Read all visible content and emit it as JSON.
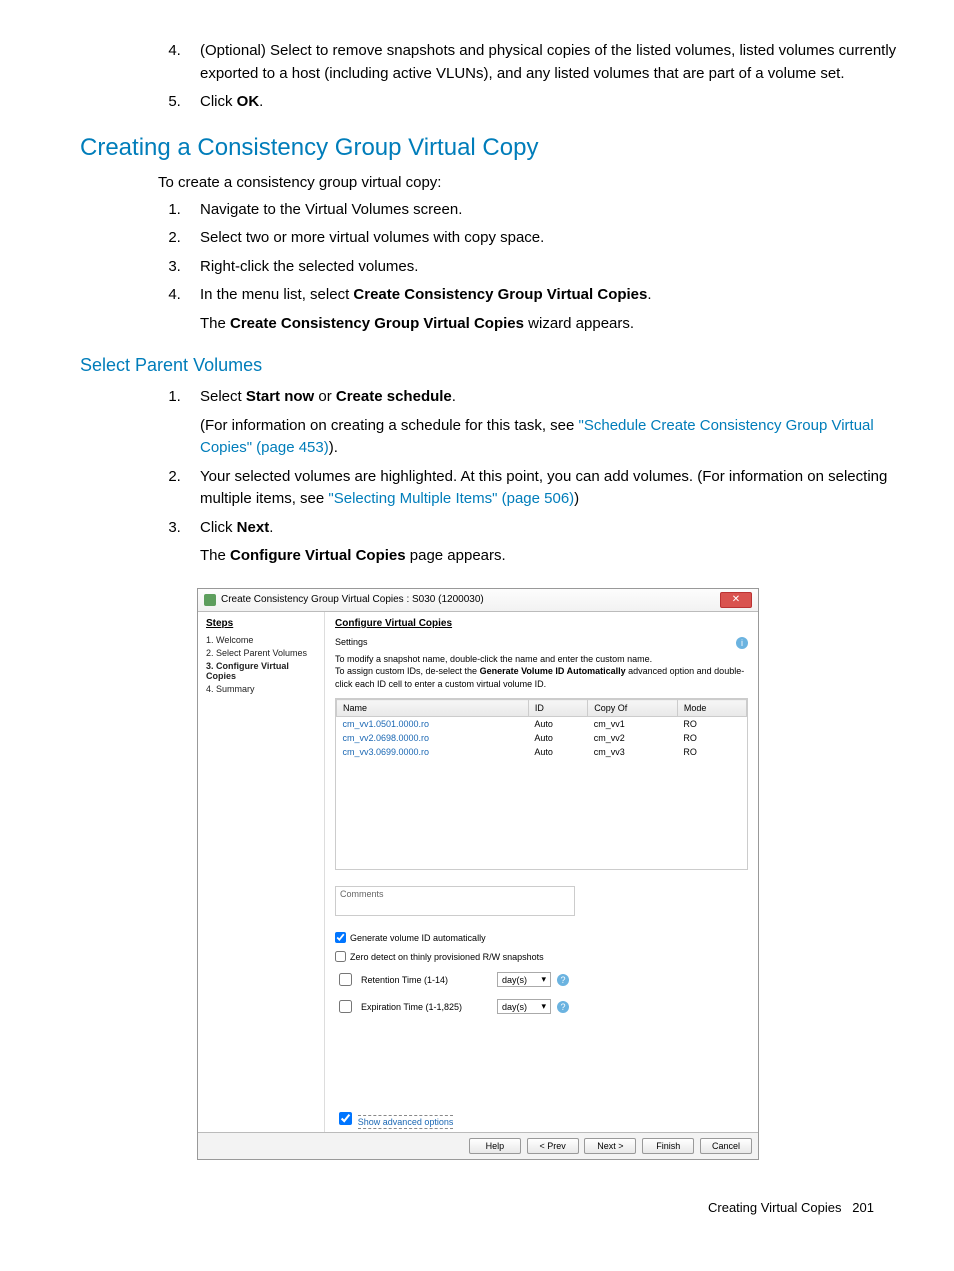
{
  "intro_list": {
    "start": 4,
    "item4": "(Optional) Select to remove snapshots and physical copies of the listed volumes, listed volumes currently exported to a host (including active VLUNs), and any listed volumes that are part of a volume set.",
    "item5_pre": "Click ",
    "item5_bold": "OK",
    "item5_post": "."
  },
  "heading1": "Creating a Consistency Group Virtual Copy",
  "intro1": "To create a consistency group virtual copy:",
  "steps1": {
    "s1": "Navigate to the Virtual Volumes screen.",
    "s2": "Select two or more virtual volumes with copy space.",
    "s3": "Right-click the selected volumes.",
    "s4_pre": "In the menu list, select ",
    "s4_bold": "Create Consistency Group Virtual Copies",
    "s4_post": ".",
    "s4_sub_pre": "The ",
    "s4_sub_bold": "Create Consistency Group Virtual Copies",
    "s4_sub_post": " wizard appears."
  },
  "heading2": "Select Parent Volumes",
  "steps2": {
    "s1_pre": "Select ",
    "s1_b1": "Start now",
    "s1_mid": " or ",
    "s1_b2": "Create schedule",
    "s1_post": ".",
    "s1_sub_pre": "(For information on creating a schedule for this task, see ",
    "s1_sub_link": "\"Schedule Create Consistency Group Virtual Copies\" (page 453)",
    "s1_sub_post": ").",
    "s2_pre": "Your selected volumes are highlighted. At this point, you can add volumes. (For information on selecting multiple items, see ",
    "s2_link": "\"Selecting Multiple Items\" (page 506)",
    "s2_post": ")",
    "s3_pre": "Click ",
    "s3_bold": "Next",
    "s3_post": ".",
    "s3_sub_pre": "The ",
    "s3_sub_bold": "Configure Virtual Copies",
    "s3_sub_post": " page appears."
  },
  "wizard": {
    "title": "Create Consistency Group Virtual Copies : S030 (1200030)",
    "sidebar_header": "Steps",
    "steps": {
      "s1": "1. Welcome",
      "s2": "2. Select Parent Volumes",
      "s3": "3. Configure Virtual Copies",
      "s4": "4. Summary"
    },
    "main_header": "Configure Virtual Copies",
    "settings_label": "Settings",
    "settings_hint_l1": "To modify a snapshot name, double-click the name and enter the custom name.",
    "settings_hint_l2a": "To assign custom IDs, de-select the ",
    "settings_hint_l2b": "Generate Volume ID Automatically",
    "settings_hint_l2c": " advanced option and double-click each ID cell to enter a custom virtual volume ID.",
    "table": {
      "cols": {
        "c1": "Name",
        "c2": "ID",
        "c3": "Copy Of",
        "c4": "Mode"
      },
      "rows": [
        {
          "c1": "cm_vv1.0501.0000.ro",
          "c2": "Auto",
          "c3": "cm_vv1",
          "c4": "RO"
        },
        {
          "c1": "cm_vv2.0698.0000.ro",
          "c2": "Auto",
          "c3": "cm_vv2",
          "c4": "RO"
        },
        {
          "c1": "cm_vv3.0699.0000.ro",
          "c2": "Auto",
          "c3": "cm_vv3",
          "c4": "RO"
        }
      ]
    },
    "comments_label": "Comments",
    "cb_generate": "Generate volume ID automatically",
    "cb_zero": "Zero detect on thinly provisioned R/W snapshots",
    "cb_retention": "Retention Time  (1-14)",
    "cb_expiration": "Expiration Time  (1-1,825)",
    "day_unit": "day(s)",
    "adv_link": "Show advanced options",
    "buttons": {
      "help": "Help",
      "prev": "< Prev",
      "next": "Next >",
      "finish": "Finish",
      "cancel": "Cancel"
    }
  },
  "footer": {
    "text": "Creating Virtual Copies",
    "page": "201"
  }
}
